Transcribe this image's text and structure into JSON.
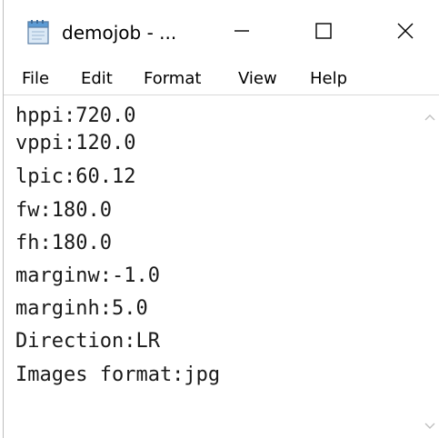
{
  "window": {
    "title": "demojob - ..."
  },
  "menu": {
    "items": [
      "File",
      "Edit",
      "Format",
      "View",
      "Help"
    ]
  },
  "editor": {
    "lines": [
      "hppi:720.0",
      "vppi:120.0",
      "lpic:60.12",
      "fw:180.0",
      "fh:180.0",
      "marginw:-1.0",
      "marginh:5.0",
      "Direction:LR",
      "Images format:jpg"
    ]
  },
  "icons": {
    "app": "notepad-icon",
    "minimize": "minimize-icon",
    "maximize": "maximize-icon",
    "close": "close-icon",
    "scroll_up": "scroll-up-arrow-icon",
    "scroll_down": "scroll-down-arrow-icon"
  },
  "colors": {
    "window_bg": "#ffffff",
    "text": "#1a1a1a",
    "icon_blue": "#5b9bd5",
    "scroll_arrow": "#c0c0c0"
  }
}
